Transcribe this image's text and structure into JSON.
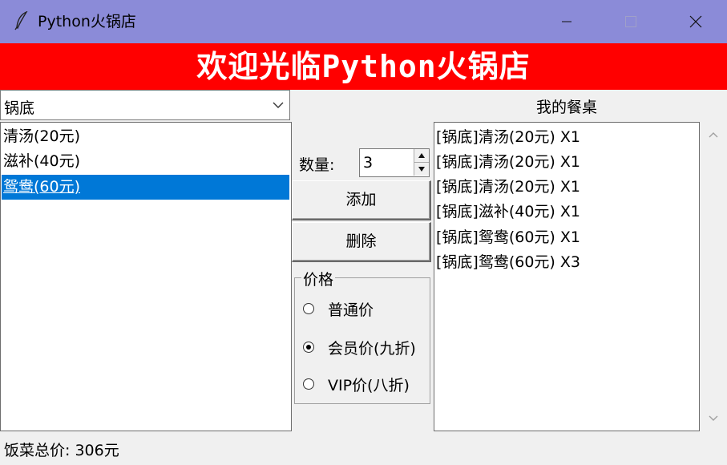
{
  "window": {
    "title": "Python火锅店",
    "title_bar_color": "#8b8bd8",
    "icons": [
      "feather-icon",
      "minimize-icon",
      "maximize-icon",
      "close-icon"
    ]
  },
  "banner": {
    "text": "欢迎光临Python火锅店",
    "background": "#ff0000"
  },
  "category": {
    "selected": "锅底"
  },
  "menu_items": [
    {
      "label": "清汤(20元)",
      "selected": false
    },
    {
      "label": "滋补(40元)",
      "selected": false
    },
    {
      "label": "鸳鸯(60元)",
      "selected": true
    }
  ],
  "quantity": {
    "label": "数量:",
    "value": "3"
  },
  "buttons": {
    "add": "添加",
    "delete": "删除"
  },
  "price": {
    "title": "价格",
    "options": [
      {
        "label": "普通价",
        "checked": false
      },
      {
        "label": "会员价(九折)",
        "checked": true
      },
      {
        "label": "VIP价(八折)",
        "checked": false
      }
    ]
  },
  "table": {
    "title": "我的餐桌",
    "items": [
      "[锅底]清汤(20元) X1",
      "[锅底]清汤(20元) X1",
      "[锅底]清汤(20元) X1",
      "[锅底]滋补(40元) X1",
      "[锅底]鸳鸯(60元) X1",
      "[锅底]鸳鸯(60元) X3"
    ]
  },
  "total": {
    "text": "饭菜总价: 306元"
  },
  "colors": {
    "selection": "#0078d7"
  }
}
